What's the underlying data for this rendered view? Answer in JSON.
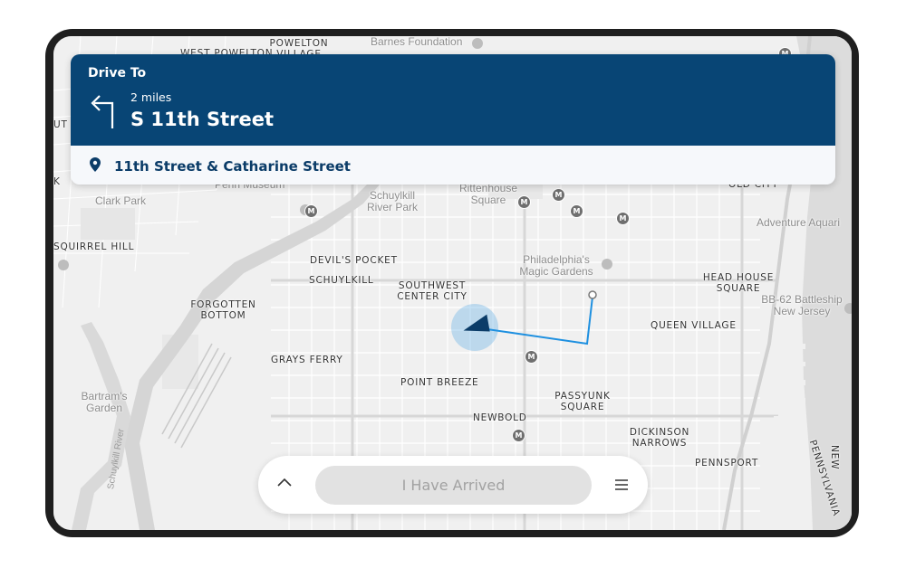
{
  "navigation": {
    "header_label": "Drive To",
    "distance": "2 miles",
    "street": "S 11th Street",
    "destination": "11th Street & Catharine Street",
    "turn_icon": "turn-left-icon",
    "pin_icon": "location-pin-icon"
  },
  "bottom_bar": {
    "arrived_label": "I Have Arrived",
    "expand_icon": "chevron-up-icon",
    "menu_icon": "hamburger-menu-icon"
  },
  "map": {
    "neighborhoods": [
      "POWELTON VILLAGE",
      "WEST POWELTON",
      "UT M",
      "K",
      "SQUIRREL HILL",
      "DEVIL'S POCKET",
      "SCHUYLKILL",
      "SOUTHWEST CENTER CITY",
      "FORGOTTEN BOTTOM",
      "GRAYS FERRY",
      "POINT BREEZE",
      "PASSYUNK SQUARE",
      "NEWBOLD",
      "DICKINSON NARROWS",
      "PENNSPORT",
      "QUEEN VILLAGE",
      "HEAD HOUSE SQUARE",
      "OLD CITY",
      "PENNSYLVANIA"
    ],
    "places": [
      "Barnes Foundation",
      "Penn Museum",
      "Clark Park",
      "Schuylkill River Park",
      "Rittenhouse Square",
      "Philadelphia's Magic Gardens",
      "Adventure Aquari",
      "BB-62 Battleship New Jersey",
      "Bartram's Garden"
    ],
    "water_labels": [
      "Schuylkill River",
      "NEW"
    ],
    "metro_symbol": "M",
    "route_color": "#1e90e0",
    "accent_color": "#084575"
  }
}
